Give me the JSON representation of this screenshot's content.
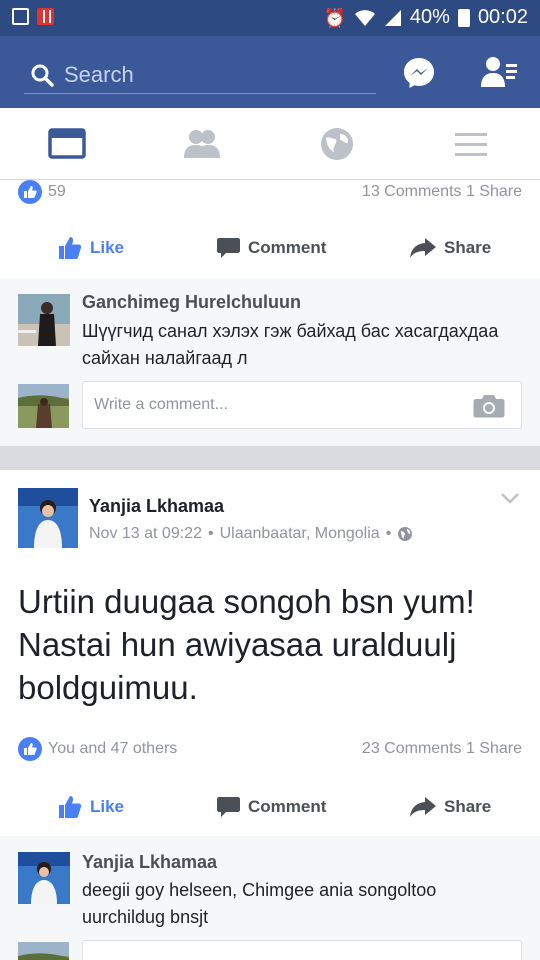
{
  "status_bar": {
    "battery": "40%",
    "time": "00:02"
  },
  "header": {
    "search_placeholder": "Search"
  },
  "nav_tabs": [
    "News Feed",
    "Friends",
    "Notifications",
    "Menu"
  ],
  "post1": {
    "likes": "59",
    "comments_shares": "13 Comments 1 Share",
    "actions": {
      "like": "Like",
      "comment": "Comment",
      "share": "Share"
    },
    "comment": {
      "author": "Ganchimeg Hurelchuluun",
      "text": "Шүүгчид санал хэлэх гэж байхад бас хасагдахдаа сайхан налайгаад л"
    },
    "write_placeholder": "Write a comment..."
  },
  "post2": {
    "author": "Yanjia Lkhamaa",
    "time": "Nov 13 at 09:22",
    "location": "Ulaanbaatar, Mongolia",
    "text": "Urtiin duugaa songoh bsn yum! Nastai hun awiyasaa uralduulj boldguimuu.",
    "reactions": "You and 47 others",
    "comments_shares": "23 Comments 1 Share",
    "actions": {
      "like": "Like",
      "comment": "Comment",
      "share": "Share"
    },
    "comment": {
      "author": "Yanjia Lkhamaa",
      "text": "deegii goy helseen, Chimgee ania songoltoo uurchildug bnsjt"
    }
  },
  "colors": {
    "brand": "#3b5998",
    "status_bar": "#2e4a82",
    "like_blue": "#4a80f5"
  }
}
